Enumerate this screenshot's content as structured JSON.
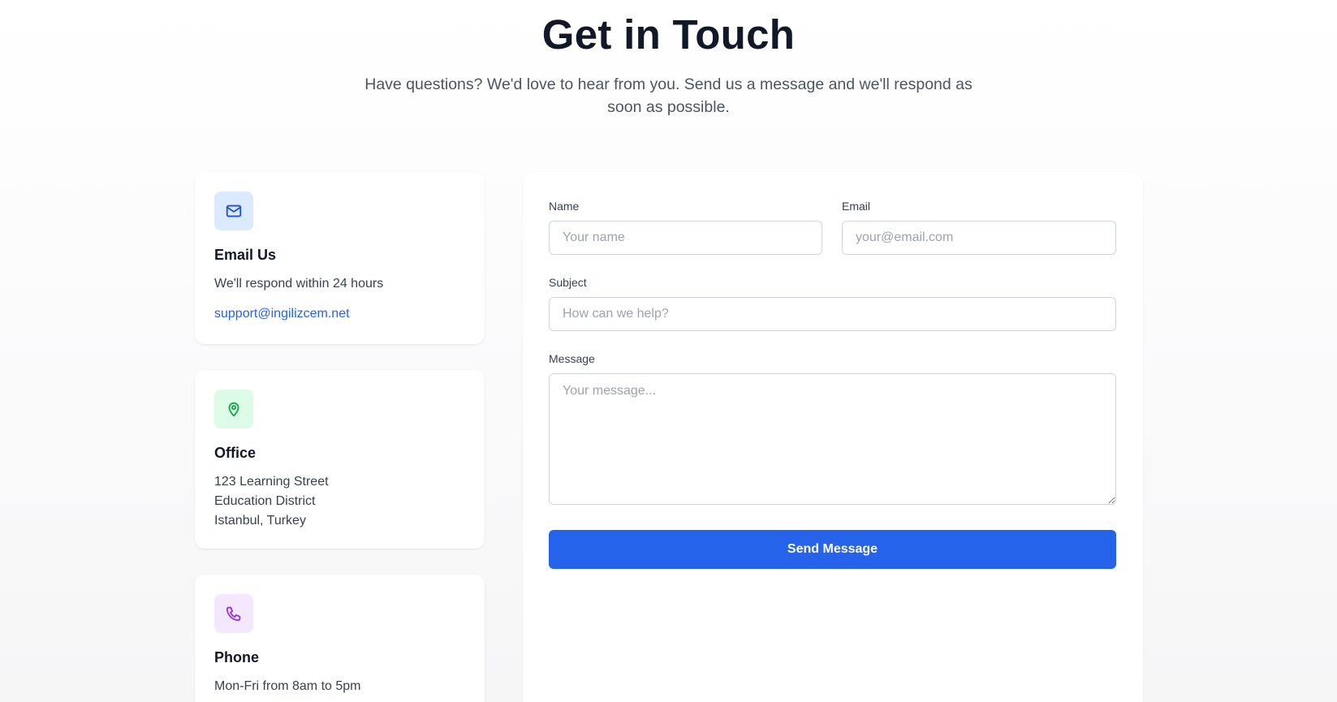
{
  "hero": {
    "title": "Get in Touch",
    "subtitle": "Have questions? We'd love to hear from you. Send us a message and we'll respond as soon as possible."
  },
  "cards": {
    "email": {
      "icon": "mail-icon",
      "title": "Email Us",
      "text": "We'll respond within 24 hours",
      "link": "support@ingilizcem.net"
    },
    "office": {
      "icon": "map-pin-icon",
      "title": "Office",
      "address_line1": "123 Learning Street",
      "address_line2": "Education District",
      "address_line3": "Istanbul, Turkey"
    },
    "phone": {
      "icon": "phone-icon",
      "title": "Phone",
      "text": "Mon-Fri from 8am to 5pm"
    }
  },
  "form": {
    "name_label": "Name",
    "name_placeholder": "Your name",
    "name_value": "",
    "email_label": "Email",
    "email_placeholder": "your@email.com",
    "email_value": "",
    "subject_label": "Subject",
    "subject_placeholder": "How can we help?",
    "subject_value": "",
    "message_label": "Message",
    "message_placeholder": "Your message...",
    "message_value": "",
    "submit_label": "Send Message"
  },
  "colors": {
    "accent": "#2563eb",
    "email_icon_bg": "#dbeafe",
    "office_icon_bg": "#dcfce7",
    "phone_icon_bg": "#f3e8ff"
  }
}
